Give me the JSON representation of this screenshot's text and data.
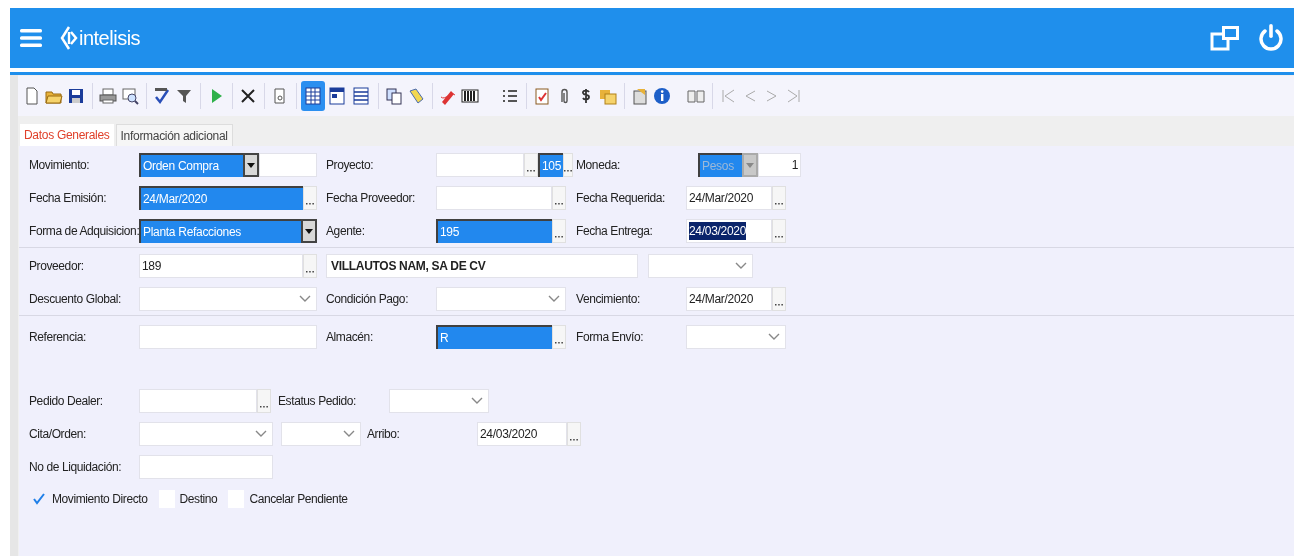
{
  "header": {
    "logo": "intelisis"
  },
  "toolbar": {
    "view_buttons": [
      {
        "selected": true
      },
      {
        "selected": false
      },
      {
        "selected": false
      }
    ]
  },
  "tabs": [
    {
      "label": "Datos Generales",
      "selected": true
    },
    {
      "label": "Información adicional",
      "selected": false
    }
  ],
  "sections": [
    {
      "rows": [
        [
          {
            "label": "Movimiento:",
            "inputs": [
              {
                "kind": "dropdown",
                "value": "Orden Compra",
                "highlighted": true
              },
              {
                "kind": "text"
              }
            ]
          },
          {
            "label": "Proyecto:",
            "inputs": [
              {
                "kind": "lookup"
              },
              {
                "kind": "lookup",
                "value": "105",
                "highlighted": true
              }
            ]
          },
          {
            "label": "Moneda:",
            "inputs": [
              {
                "kind": "dropdown",
                "value": "Pesos",
                "highlighted": true,
                "disabled": true
              },
              {
                "kind": "number",
                "value": "1"
              }
            ]
          }
        ],
        [
          {
            "label": "Fecha Emisión:",
            "inputs": [
              {
                "kind": "lookup",
                "value": "24/Mar/2020",
                "highlighted": true
              }
            ]
          },
          {
            "label": "Fecha Proveedor:",
            "inputs": [
              {
                "kind": "lookup"
              }
            ]
          },
          {
            "label": "Fecha Requerida:",
            "inputs": [
              {
                "kind": "lookup",
                "value": "24/Mar/2020"
              }
            ]
          }
        ],
        [
          {
            "label": "Forma de Adquisicion:",
            "inputs": [
              {
                "kind": "dropdown",
                "value": "Planta Refacciones",
                "highlighted": true
              }
            ]
          },
          {
            "label": "Agente:",
            "inputs": [
              {
                "kind": "lookup",
                "value": "195",
                "highlighted": true
              }
            ]
          },
          {
            "label": "Fecha Entrega:",
            "inputs": [
              {
                "kind": "lookup",
                "value": "24/03/2020",
                "text_selected": true
              }
            ]
          }
        ]
      ]
    },
    {
      "rows": [
        [
          {
            "label": "Proveedor:",
            "inputs": [
              {
                "kind": "lookup",
                "value": "189"
              },
              {
                "kind": "name",
                "value": "VILLAUTOS NAM, SA DE CV"
              },
              {
                "kind": "combo"
              }
            ]
          }
        ],
        [
          {
            "label": "Descuento Global:",
            "inputs": [
              {
                "kind": "combo"
              }
            ]
          },
          {
            "label": "Condición Pago:",
            "inputs": [
              {
                "kind": "combo"
              }
            ]
          },
          {
            "label": "Vencimiento:",
            "inputs": [
              {
                "kind": "lookup",
                "value": "24/Mar/2020"
              }
            ]
          }
        ]
      ]
    },
    {
      "rows": [
        [
          {
            "label": "Referencia:",
            "inputs": [
              {
                "kind": "text"
              }
            ]
          },
          {
            "label": "Almacén:",
            "inputs": [
              {
                "kind": "lookup",
                "value": "R",
                "highlighted": true
              }
            ]
          },
          {
            "label": "Forma Envío:",
            "inputs": [
              {
                "kind": "combo"
              }
            ]
          }
        ]
      ]
    },
    {
      "rows": [
        [
          {
            "label": "Pedido Dealer:",
            "inputs": [
              {
                "kind": "lookup"
              }
            ]
          },
          {
            "label": "Estatus Pedido:",
            "inputs": [
              {
                "kind": "combo"
              }
            ]
          }
        ],
        [
          {
            "label": "Cita/Orden:",
            "inputs": [
              {
                "kind": "combo"
              },
              {
                "kind": "combo"
              }
            ]
          },
          {
            "label": "Arribo:",
            "inputs": [
              {
                "kind": "lookup",
                "value": "24/03/2020"
              }
            ]
          }
        ],
        [
          {
            "label": "No de Liquidación:",
            "inputs": [
              {
                "kind": "text"
              }
            ]
          }
        ]
      ]
    }
  ],
  "checkboxes": [
    {
      "label": "Movimiento Directo",
      "checked": true
    },
    {
      "label": "Destino",
      "checked": false
    },
    {
      "label": "Cancelar Pendiente",
      "checked": false
    }
  ]
}
